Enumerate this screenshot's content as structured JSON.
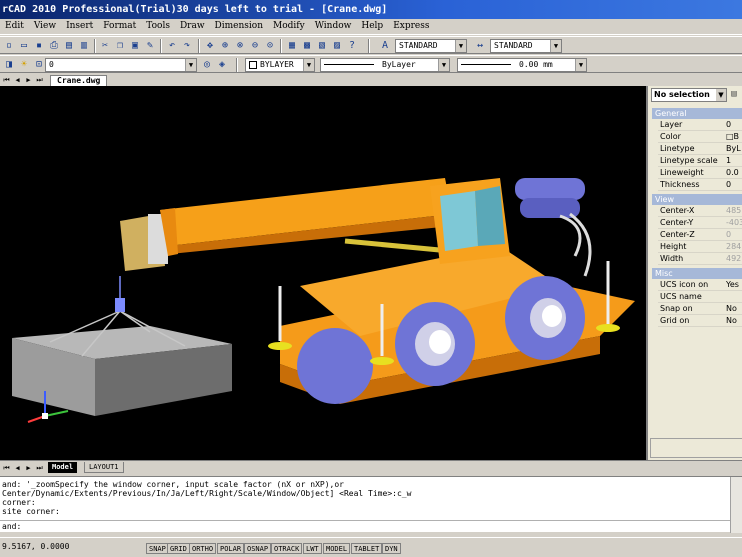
{
  "window": {
    "title": "rCAD 2010 Professional(Trial)30 days left to trial - [Crane.dwg]"
  },
  "menu": [
    "Edit",
    "View",
    "Insert",
    "Format",
    "Tools",
    "Draw",
    "Dimension",
    "Modify",
    "Window",
    "Help",
    "Express"
  ],
  "toolbar1": {
    "text_style": "STANDARD",
    "dim_style": "STANDARD"
  },
  "toolbar2": {
    "layer": "0",
    "color": "BYLAYER",
    "linetype": "ByLayer",
    "lineweight": "0.00 mm"
  },
  "document_tab": "Crane.dwg",
  "properties": {
    "selection": "No selection",
    "categories": {
      "general": "General",
      "view": "View",
      "misc": "Misc"
    },
    "general": [
      {
        "key": "Layer",
        "value": "0"
      },
      {
        "key": "Color",
        "value": "□B"
      },
      {
        "key": "Linetype",
        "value": "ByL"
      },
      {
        "key": "Linetype scale",
        "value": "1"
      },
      {
        "key": "Lineweight",
        "value": "0.0"
      },
      {
        "key": "Thickness",
        "value": "0"
      }
    ],
    "view": [
      {
        "key": "Center-X",
        "value": "485"
      },
      {
        "key": "Center-Y",
        "value": "-403"
      },
      {
        "key": "Center-Z",
        "value": "0"
      },
      {
        "key": "Height",
        "value": "284"
      },
      {
        "key": "Width",
        "value": "492"
      }
    ],
    "misc": [
      {
        "key": "UCS icon on",
        "value": "Yes"
      },
      {
        "key": "UCS name",
        "value": ""
      },
      {
        "key": "Snap on",
        "value": "No"
      },
      {
        "key": "Grid on",
        "value": "No"
      }
    ]
  },
  "layout_tabs": [
    "Model",
    "LAYOUT1"
  ],
  "command": {
    "lines": [
      "and: '_zoomSpecify the window corner, input scale factor (nX or nXP),or",
      "Center/Dynamic/Extents/Previous/In/Ja/Left/Right/Scale/Window/Object] <Real Time>:c_w",
      "corner:",
      "site corner:"
    ],
    "prompt": "and:"
  },
  "status": {
    "coords": "9.5167, 0.0000",
    "buttons": [
      "SNAP",
      "GRID",
      "ORTHO",
      "POLAR",
      "OSNAP",
      "OTRACK",
      "LWT",
      "MODEL",
      "TABLET",
      "DYN"
    ]
  },
  "colors": {
    "crane_body": "#f59b1a",
    "crane_shadow": "#c86e08",
    "tires": "#6f74d6",
    "cab_glass": "#7ec8d6",
    "box": "#8a8a8a"
  }
}
